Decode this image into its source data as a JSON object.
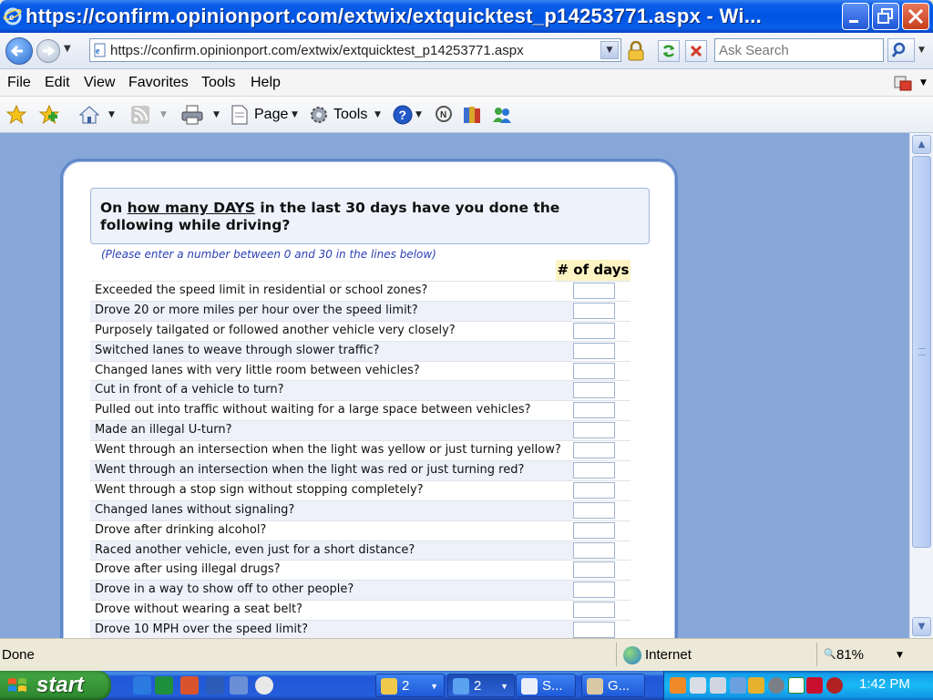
{
  "window": {
    "title": "https://confirm.opinionport.com/extwix/extquicktest_p14253771.aspx - Wi..."
  },
  "address_bar": {
    "url": "https://confirm.opinionport.com/extwix/extquicktest_p14253771.aspx",
    "search_placeholder": "Ask Search"
  },
  "menu": {
    "items": [
      "File",
      "Edit",
      "View",
      "Favorites",
      "Tools",
      "Help"
    ]
  },
  "command_bar": {
    "page_label": "Page",
    "tools_label": "Tools"
  },
  "survey": {
    "question_prefix": "On ",
    "question_emphasis": "how many DAYS",
    "question_suffix": " in the last 30 days have you done the following while driving?",
    "instruction": "(Please enter a number between 0 and 30 in the lines below)",
    "column_header": "# of days",
    "rows": [
      "Exceeded the speed limit in residential or school zones?",
      "Drove 20 or more miles per hour over the speed limit?",
      "Purposely tailgated or followed another vehicle very closely?",
      "Switched lanes to weave through slower traffic?",
      "Changed lanes with very little room between vehicles?",
      "Cut in front of a vehicle to turn?",
      "Pulled out into traffic without waiting for a large space between vehicles?",
      "Made an illegal U-turn?",
      "Went through an intersection when the light was yellow or just turning yellow?",
      "Went through an intersection when the light was red or just turning red?",
      "Went through a stop sign without stopping completely?",
      "Changed lanes without signaling?",
      "Drove after drinking alcohol?",
      "Raced another vehicle, even just for a short distance?",
      "Drove after using illegal drugs?",
      "Drove in a way to show off to other people?",
      "Drove without wearing a seat belt?",
      "Drove 10 MPH over the speed limit?"
    ]
  },
  "status_bar": {
    "status": "Done",
    "zone": "Internet",
    "zoom": "81%"
  },
  "taskbar": {
    "start_label": "start",
    "tasks": [
      {
        "label": "2",
        "icon": "folder-icon"
      },
      {
        "label": "2",
        "icon": "ie-icon"
      },
      {
        "label": "S...",
        "icon": "word-icon"
      },
      {
        "label": "G...",
        "icon": "app-icon"
      }
    ],
    "clock": "1:42 PM"
  },
  "colors": {
    "titlebar": "#0054e3",
    "page_background": "#87a7d8",
    "panel_border": "#5f87c9",
    "question_box": "#edf2fb",
    "instruction_text": "#2a3fb5",
    "column_header_bg": "#fdf4c4",
    "row_alt": "#eef1fa",
    "start_button": "#3fa33f"
  }
}
